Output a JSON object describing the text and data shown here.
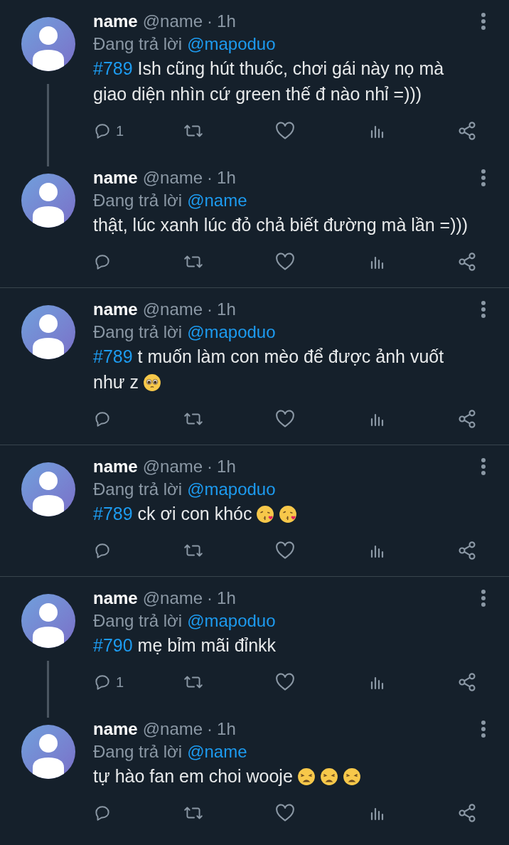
{
  "tweets": [
    {
      "name": "name",
      "handle": "@name",
      "separator": "·",
      "time": "1h",
      "reply_label": "Đang trả lời",
      "reply_to": "@mapoduo",
      "tag": "#789",
      "text": "Ish cũng hút thuốc, chơi gái này nọ mà giao diện nhìn cứ green thế đ nào nhỉ =)))",
      "reply_count": "1",
      "threaded": true
    },
    {
      "name": "name",
      "handle": "@name",
      "separator": "·",
      "time": "1h",
      "reply_label": "Đang trả lời",
      "reply_to": "@name",
      "text": "thật, lúc xanh lúc đỏ chả biết đường mà lần =)))",
      "threaded": false
    },
    {
      "name": "name",
      "handle": "@name",
      "separator": "·",
      "time": "1h",
      "reply_label": "Đang trả lời",
      "reply_to": "@mapoduo",
      "tag": "#789",
      "text": "t muốn làm con mèo để được ảnh vuốt như z",
      "emojis": [
        {
          "kind": "pleading"
        }
      ],
      "threaded": false
    },
    {
      "name": "name",
      "handle": "@name",
      "separator": "·",
      "time": "1h",
      "reply_label": "Đang trả lời",
      "reply_to": "@mapoduo",
      "tag": "#789",
      "text": "ck ơi con khóc",
      "emojis": [
        {
          "kind": "kiss"
        },
        {
          "kind": "kiss"
        }
      ],
      "threaded": false
    },
    {
      "name": "name",
      "handle": "@name",
      "separator": "·",
      "time": "1h",
      "reply_label": "Đang trả lời",
      "reply_to": "@mapoduo",
      "tag": "#790",
      "text": "mẹ bỉm mãi đỉnkk",
      "reply_count": "1",
      "threaded": true
    },
    {
      "name": "name",
      "handle": "@name",
      "separator": "·",
      "time": "1h",
      "reply_label": "Đang trả lời",
      "reply_to": "@name",
      "text": "tự hào fan em choi wooje",
      "emojis": [
        {
          "kind": "weary"
        },
        {
          "kind": "weary"
        },
        {
          "kind": "weary"
        }
      ],
      "threaded": false
    }
  ]
}
